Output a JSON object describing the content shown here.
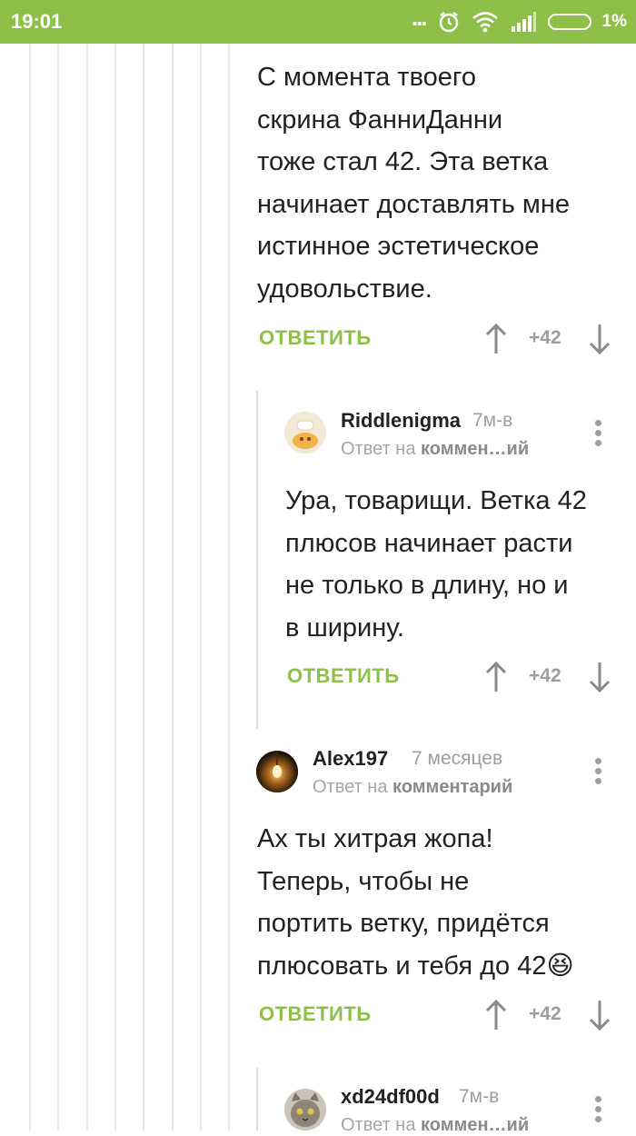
{
  "status_bar": {
    "time": "19:01",
    "dots": "...",
    "battery_percent": "1%",
    "icons": [
      "alarm-icon",
      "wifi-icon",
      "signal-icon",
      "battery-icon"
    ]
  },
  "colors": {
    "accent": "#8ec049",
    "text": "#222222",
    "muted": "#9e9e9e"
  },
  "comments": [
    {
      "text": "С момента твоего скрина ФанниДанни тоже стал 42. Эта ветка начинает доставлять мне истинное эстетическое удовольствие.",
      "lines": [
        "С момента твоего",
        "скрина ФанниДанни",
        "тоже стал 42. Эта ветка",
        "начинает доставлять мне",
        "истинное эстетическое",
        "удовольствие."
      ],
      "reply_label": "ОТВЕТИТЬ",
      "rating": "+42"
    },
    {
      "username": "Riddlenigma",
      "time": "7м-в",
      "reply_to_prefix": "Ответ на",
      "reply_to_target": "коммен…ий",
      "lines": [
        "Ура, товарищи. Ветка 42",
        "плюсов начинает расти",
        "не только в длину, но и",
        "в ширину."
      ],
      "reply_label": "ОТВЕТИТЬ",
      "rating": "+42"
    },
    {
      "username": "Alex197",
      "time": "7 месяцев",
      "reply_to_prefix": "Ответ на",
      "reply_to_target": "комментарий",
      "lines": [
        "Ах ты хитрая жопа!",
        "Теперь, чтобы не",
        "портить ветку, придётся",
        "плюсовать и тебя до 42"
      ],
      "emoji": "😆",
      "reply_label": "ОТВЕТИТЬ",
      "rating": "+42"
    },
    {
      "username": "xd24df00d",
      "time": "7м-в",
      "reply_to_prefix": "Ответ на",
      "reply_to_target": "коммен…ий"
    }
  ]
}
